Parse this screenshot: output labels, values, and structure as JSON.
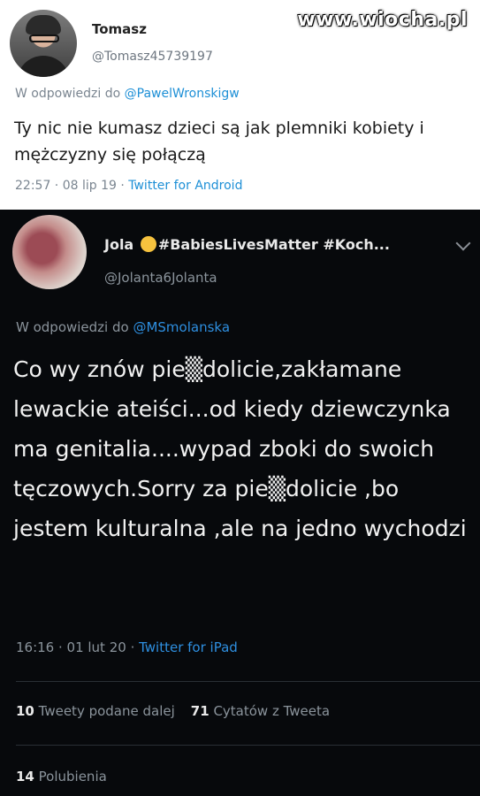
{
  "watermark": "www.wiocha.pl",
  "tweet1": {
    "name": "Tomasz",
    "handle": "@Tomasz45739197",
    "reply_prefix": "W odpowiedzi do ",
    "reply_mention": "@PawelWronskigw",
    "text": "Ty nic nie kumasz dzieci są jak plemniki kobiety i mężczyzny się połączą",
    "meta_time": "22:57 · 08 lip 19 · ",
    "meta_source": "Twitter for Android"
  },
  "tweet2": {
    "name_start": "Jola",
    "name_rest": "#BabiesLivesMatter #Koch...",
    "handle": "@Jolanta6Jolanta",
    "reply_prefix": "W odpowiedzi do ",
    "reply_mention": "@MSmolanska",
    "text": "Co wy znów pie▒dolicie,zakłamane lewackie ateiści...od kiedy dziewczynka ma genitalia....wypad zboki do swoich tęczowych.Sorry za pie▒dolicie ,bo jestem kulturalna ,ale na jedno wychodzi",
    "meta_time": "16:16 · 01 lut 20 · ",
    "meta_source": "Twitter for iPad",
    "retweets_count": "10",
    "retweets_label": "Tweety podane dalej",
    "quotes_count": "71",
    "quotes_label": "Cytatów z Tweeta",
    "likes_count": "14",
    "likes_label": "Polubienia"
  },
  "colors": {
    "link_light": "#1d8fd6",
    "link_dark": "#2e8fe0",
    "dark_bg": "#07090c"
  },
  "icons": {
    "tweet2_emoji": "smiling-face-emoji",
    "tweet2_menu": "chevron-down-icon"
  }
}
